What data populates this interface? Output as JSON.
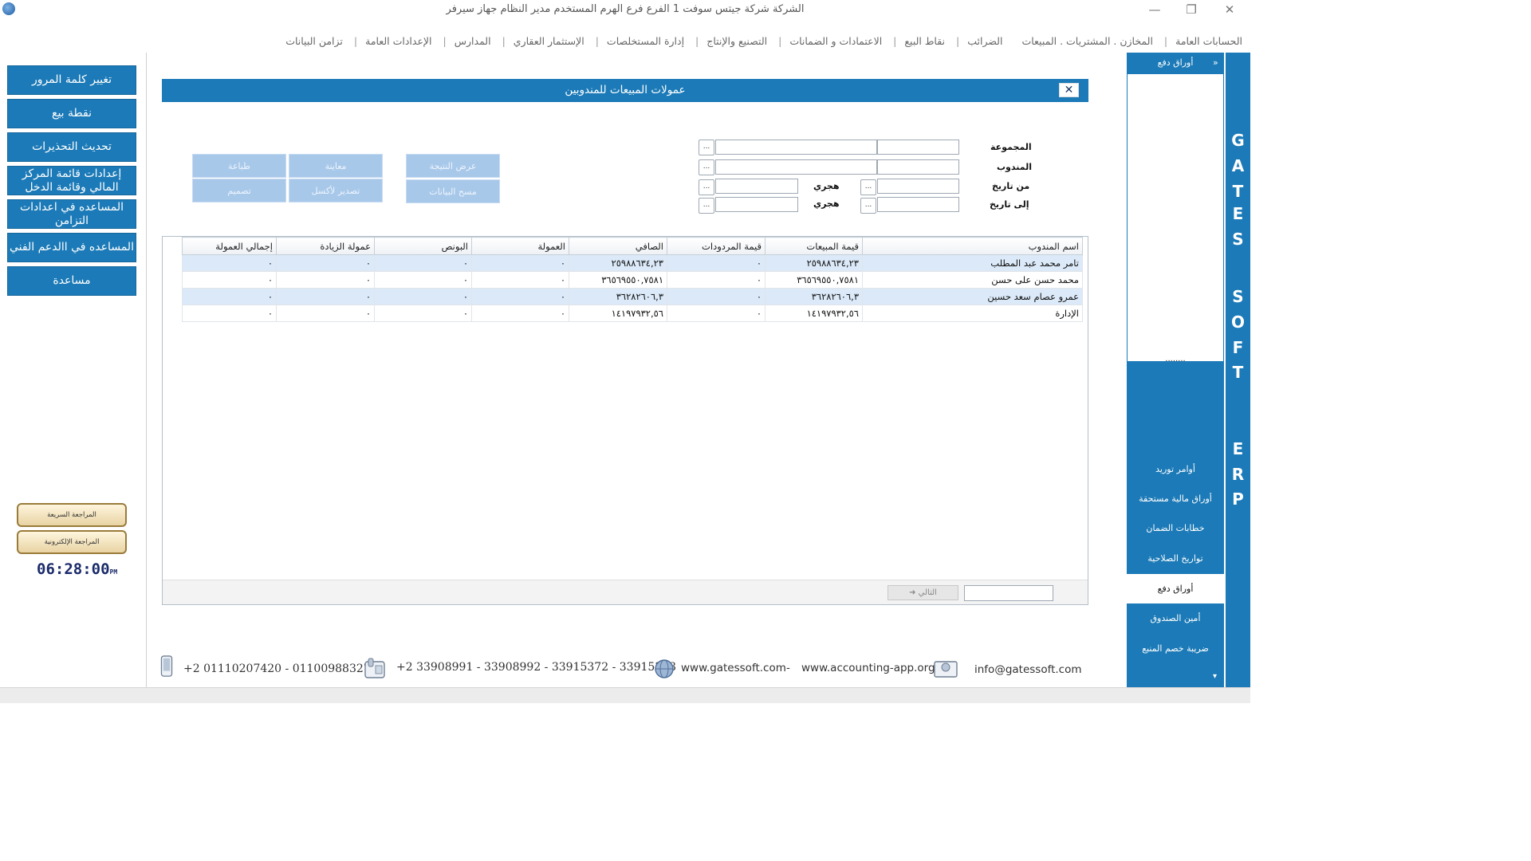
{
  "window": {
    "title": "الشركة شركة جيتس سوفت 1   الفرع فرع الهرم   المستخدم مدير النظام   جهاز سيرفر",
    "minimize": "—",
    "restore": "❐",
    "close": "✕"
  },
  "menu": [
    "الحسابات العامة",
    "المخازن . المشتريات . المبيعات",
    "الضرائب",
    "نقاط البيع",
    "الاعتمادات و الضمانات",
    "التصنيع والإنتاج",
    "إدارة المستخلصات",
    "الإستثمار العقاري",
    "المدارس",
    "الإعدادات العامة",
    "تزامن البيانات"
  ],
  "left_buttons": [
    "تغيير كلمة المرور",
    "نقطة بيع",
    "تحديث التحذيرات",
    "إعدادات قائمة المركز المالي وقائمة الدخل",
    "المساعده في اعدادات التزامن",
    "المساعده في االدعم الفني",
    "مساعدة"
  ],
  "review": {
    "quick": "المراجعة السريعة",
    "electronic": "المراجعة الإلكترونية"
  },
  "clock": {
    "time": "06:28:00",
    "ampm": "PM"
  },
  "modal": {
    "title": "عمولات المبيعات للمندوبين",
    "close": "✕",
    "labels": {
      "group": "المجموعة",
      "rep": "المندوب",
      "from_date": "من تاريخ",
      "to_date": "إلى تاريخ",
      "hijri": "هجري",
      "dots": "..."
    },
    "buttons": {
      "print": "طباعة",
      "preview": "معاينة",
      "show_result": "عرض النتيجة",
      "design": "تصميم",
      "export_excel": "تصدير لأكسل",
      "clear_data": "مسح البيانات"
    },
    "table": {
      "headers": [
        "اسم المندوب",
        "قيمة المبيعات",
        "قيمة المردودات",
        "الصافي",
        "العمولة",
        "البونص",
        "عمولة الزيادة",
        "إجمالي العمولة"
      ],
      "rows": [
        [
          "تامر محمد عبد المطلب",
          "٢٥٩٨٨٦٣٤,٢٣",
          "٠",
          "٢٥٩٨٨٦٣٤,٢٣",
          "٠",
          "٠",
          "٠",
          "٠"
        ],
        [
          "محمد حسن على حسن",
          "٣٦٥٦٩٥٥٠,٧٥٨١",
          "٠",
          "٣٦٥٦٩٥٥٠,٧٥٨١",
          "٠",
          "٠",
          "٠",
          "٠"
        ],
        [
          "عمرو عصام سعد حسين",
          "٣٦٢٨٢٦٠٦,٣",
          "٠",
          "٣٦٢٨٢٦٠٦,٣",
          "٠",
          "٠",
          "٠",
          "٠"
        ],
        [
          "الإدارة",
          "١٤١٩٧٩٣٢,٥٦",
          "٠",
          "١٤١٩٧٩٣٢,٥٦",
          "٠",
          "٠",
          "٠",
          "٠"
        ]
      ]
    },
    "next_button": "التالي"
  },
  "footer": {
    "mobile": "+2 01110207420  - 01100988327",
    "phone": "+2 33908991 - 33908992 - 33915372 - 33915373",
    "website": "www.gatessoft.com",
    "dash": "-",
    "website2": "www.accounting-app.org",
    "email": "info@gatessoft.com"
  },
  "right_panel": {
    "header": "أوراق دفع",
    "collapse": "«",
    "dots": "........",
    "items": [
      "أوامر توريد",
      "أوراق مالية مستحقة",
      "خطابات الضمان",
      "تواريخ الصلاحية",
      "أوراق دفع",
      "أمين الصندوق",
      "ضريبة خصم المنبع"
    ],
    "active_index": 4,
    "scroll_down": "▾"
  },
  "brand_letters": [
    "G",
    "A",
    "T",
    "E",
    "S",
    "S",
    "O",
    "F",
    "T",
    "E",
    "R",
    "P"
  ],
  "colors": {
    "primary": "#1b7ab7",
    "disabled_button": "#a8c8ea",
    "row_alt": "#dbe9f8"
  }
}
